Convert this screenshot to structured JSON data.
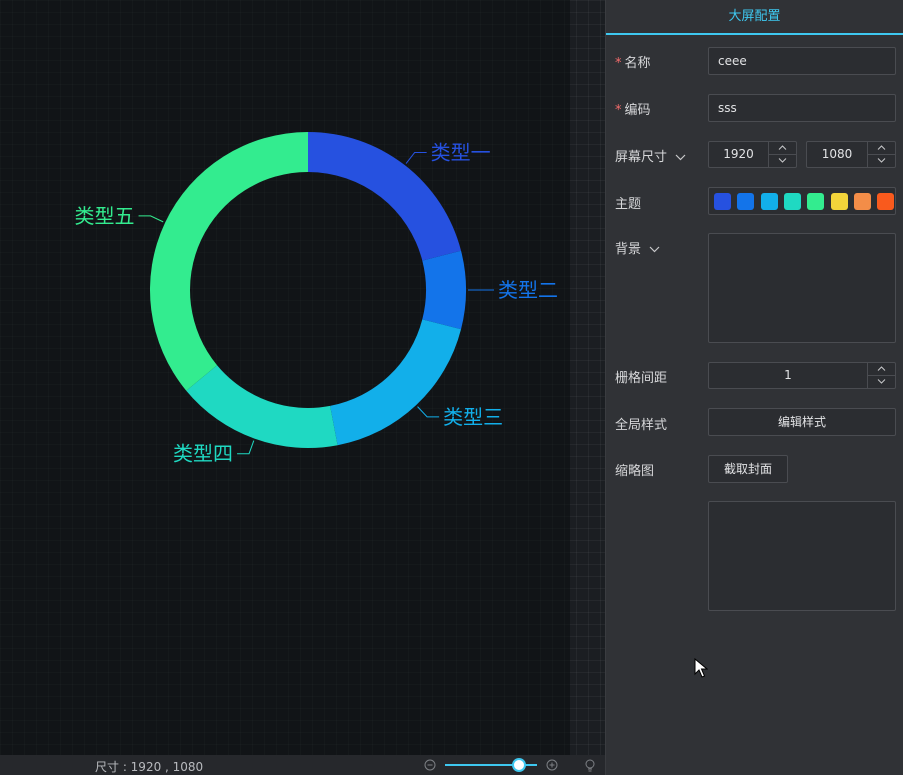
{
  "chart_data": {
    "type": "pie",
    "donut": true,
    "categories": [
      "类型一",
      "类型二",
      "类型三",
      "类型四",
      "类型五"
    ],
    "values": [
      21,
      8,
      18,
      17,
      36
    ],
    "colors": [
      "#2651e0",
      "#1374ea",
      "#12afea",
      "#1fd9c2",
      "#33ec8f"
    ],
    "title": "",
    "label_position": "outside"
  },
  "status_bar": {
    "size_text": "尺寸 : 1920 , 1080",
    "zoom_fraction": 0.8
  },
  "panel": {
    "title": "大屏配置",
    "name": {
      "label": "名称",
      "required_mark": "*",
      "value": "ceee"
    },
    "code": {
      "label": "编码",
      "required_mark": "*",
      "value": "sss"
    },
    "screen_size": {
      "label": "屏幕尺寸",
      "width": "1920",
      "height": "1080"
    },
    "theme": {
      "label": "主题",
      "swatches": [
        "#2651e0",
        "#1374ea",
        "#12afea",
        "#1fd9c2",
        "#33ec8f",
        "#f2d43a",
        "#f38d48",
        "#f95a1d"
      ]
    },
    "background": {
      "label": "背景"
    },
    "grid_gap": {
      "label": "栅格间距",
      "value": "1"
    },
    "global_style": {
      "label": "全局样式",
      "button": "编辑样式"
    },
    "thumbnail": {
      "label": "缩略图",
      "button": "截取封面"
    }
  },
  "icons": {
    "zoom_out": "zoom-out-icon",
    "zoom_in": "zoom-in-icon",
    "bulb": "lightbulb-icon",
    "chevron": "chevron-down-icon",
    "cursor": "mouse-cursor-icon"
  }
}
